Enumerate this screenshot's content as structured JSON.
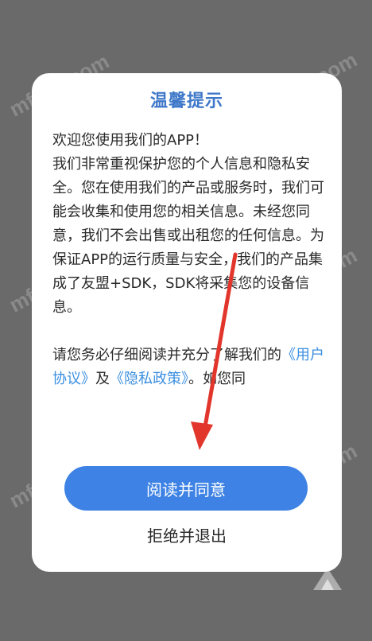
{
  "dialog": {
    "title": "温馨提示",
    "paragraphs": [
      "欢迎您使用我们的APP！",
      "我们非常重视保护您的个人信息和隐私安全。您在使用我们的产品或服务时，我们可能会收集和使用您的相关信息。未经您同意，我们不会出售或出租您的任何信息。为保证APP的运行质量与安全，我们的产品集成了友盟+SDK，SDK将采集您的设备信息。"
    ],
    "consent": {
      "prefix": "请您务必仔细阅读并充分了解我们的",
      "user_agreement": "《用户协议》",
      "and": "及",
      "privacy_policy": "《隐私政策》",
      "suffix": "。如您同"
    },
    "agree_label": "阅读并同意",
    "refuse_label": "拒绝并退出"
  },
  "watermark": {
    "text": "mfunz.com"
  },
  "colors": {
    "title": "#3f78c9",
    "link": "#3b8fe0",
    "button": "#3d82e4",
    "arrow": "#e2362c",
    "overlay": "#6a6a6a"
  }
}
